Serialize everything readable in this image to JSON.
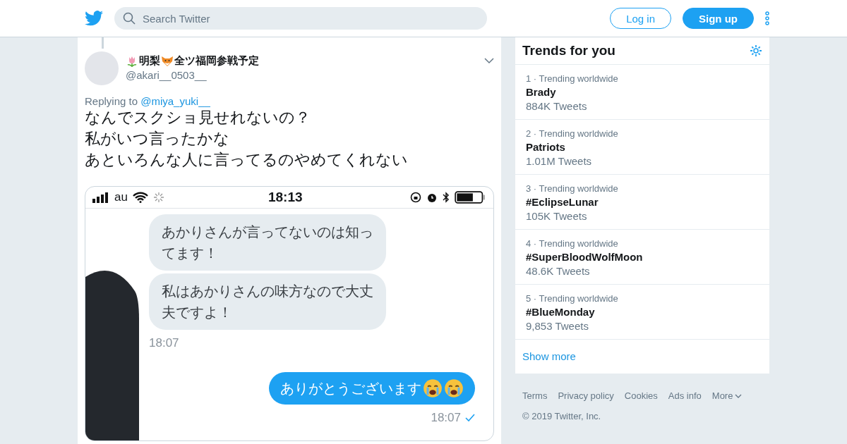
{
  "header": {
    "search": {
      "placeholder": "Search Twitter"
    },
    "buttons": [
      {
        "label": "Log in",
        "kind": "outline"
      },
      {
        "label": "Sign up",
        "kind": "filled"
      }
    ]
  },
  "tweet": {
    "name_parts": [
      "明梨",
      "全ツ福岡参戦予定"
    ],
    "handle": "@akari__0503__",
    "replying_label": "Replying to",
    "reply_to": "@miya_yuki__",
    "lines": [
      "なんでスクショ見せれないの？",
      "私がいつ言ったかな",
      "あといろんな人に言ってるのやめてくれない"
    ],
    "screenshot": {
      "carrier": "au",
      "clock": "18:13",
      "messages": [
        {
          "kind": "received",
          "text": "あかりさんが言ってないのは知ってます！"
        },
        {
          "kind": "received",
          "text": "私はあかりさんの味方なので大丈夫ですよ！"
        },
        {
          "kind": "received_time",
          "text": "18:07"
        },
        {
          "kind": "sent",
          "text": "ありがとうございます"
        },
        {
          "kind": "sent_time",
          "text": "18:07",
          "read": true
        }
      ]
    }
  },
  "trends": {
    "title": "Trends for you",
    "items": [
      {
        "meta": "1 · Trending worldwide",
        "name": "Brady",
        "count": "884K Tweets"
      },
      {
        "meta": "2 · Trending worldwide",
        "name": "Patriots",
        "count": "1.01M Tweets"
      },
      {
        "meta": "3 · Trending worldwide",
        "name": "#EclipseLunar",
        "count": "105K Tweets"
      },
      {
        "meta": "4 · Trending worldwide",
        "name": "#SuperBloodWolfMoon",
        "count": "48.6K Tweets"
      },
      {
        "meta": "5 · Trending worldwide",
        "name": "#BlueMonday",
        "count": "9,853 Tweets"
      }
    ],
    "show_more": "Show more"
  },
  "footer": {
    "links": [
      "Terms",
      "Privacy policy",
      "Cookies",
      "Ads info",
      "More"
    ],
    "copyright": "© 2019 Twitter, Inc."
  }
}
